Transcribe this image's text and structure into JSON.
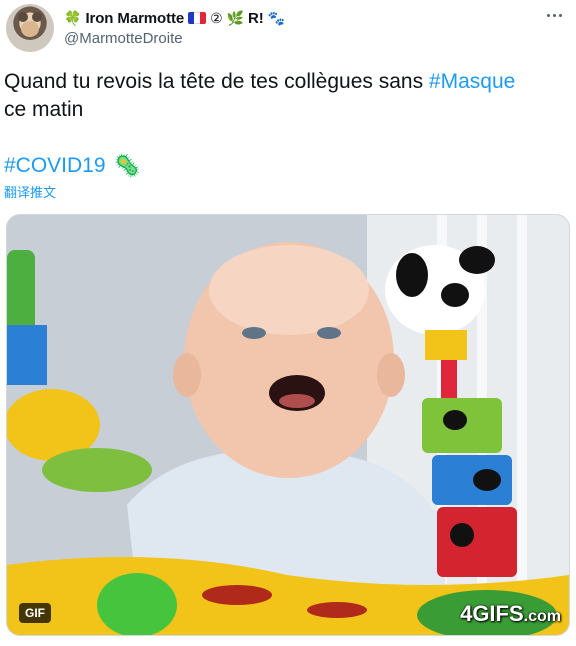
{
  "author": {
    "display_name": "Iron Marmotte",
    "emojis_before": "🍀",
    "flag": [
      "#1d3bbf",
      "#ffffff",
      "#e0263a"
    ],
    "emojis_after": "② 🌿",
    "suffix": "R!",
    "paw_emoji": "🐾",
    "handle": "@MarmotteDroite"
  },
  "tweet": {
    "text_before": "Quand tu revois la tête de tes collègues sans ",
    "hashtag_1": "#Masque",
    "text_after": " ce matin",
    "hashtag_2": "#COVID19",
    "microbe_emoji": "🦠",
    "translate_label": "翻译推文"
  },
  "media": {
    "badge": "GIF",
    "watermark_main": "4GIFS",
    "watermark_tld": ".com"
  },
  "icons": {
    "more": "more-horizontal-icon"
  }
}
